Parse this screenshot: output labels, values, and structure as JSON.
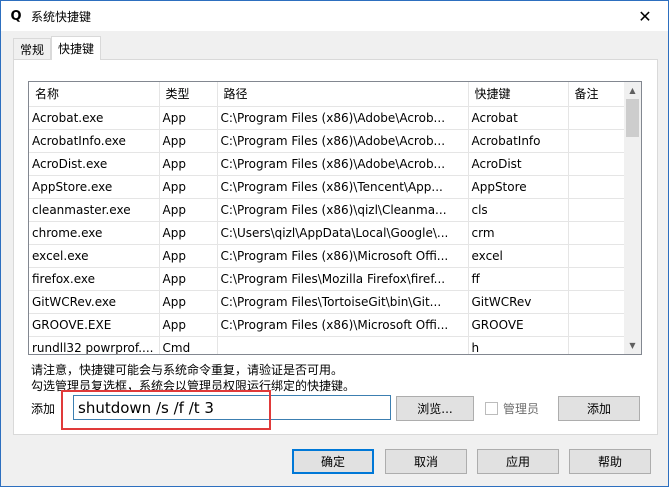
{
  "window": {
    "icon_glyph": "Q",
    "title": "系统快捷键",
    "close_glyph": "✕"
  },
  "tabs": [
    {
      "label": "常规",
      "active": false
    },
    {
      "label": "快捷键",
      "active": true
    }
  ],
  "table": {
    "columns": [
      "名称",
      "类型",
      "路径",
      "快捷键",
      "备注"
    ],
    "rows": [
      [
        "Acrobat.exe",
        "App",
        "C:\\Program Files (x86)\\Adobe\\Acrob...",
        "Acrobat",
        ""
      ],
      [
        "AcrobatInfo.exe",
        "App",
        "C:\\Program Files (x86)\\Adobe\\Acrob...",
        "AcrobatInfo",
        ""
      ],
      [
        "AcroDist.exe",
        "App",
        "C:\\Program Files (x86)\\Adobe\\Acrob...",
        "AcroDist",
        ""
      ],
      [
        "AppStore.exe",
        "App",
        "C:\\Program Files (x86)\\Tencent\\App...",
        "AppStore",
        ""
      ],
      [
        "cleanmaster.exe",
        "App",
        "C:\\Program Files (x86)\\qizl\\Cleanma...",
        "cls",
        ""
      ],
      [
        "chrome.exe",
        "App",
        "C:\\Users\\qizl\\AppData\\Local\\Google\\...",
        "crm",
        ""
      ],
      [
        "excel.exe",
        "App",
        "C:\\Program Files (x86)\\Microsoft Offi...",
        "excel",
        ""
      ],
      [
        "firefox.exe",
        "App",
        "C:\\Program Files\\Mozilla Firefox\\firef...",
        "ff",
        ""
      ],
      [
        "GitWCRev.exe",
        "App",
        "C:\\Program Files\\TortoiseGit\\bin\\Git...",
        "GitWCRev",
        ""
      ],
      [
        "GROOVE.EXE",
        "App",
        "C:\\Program Files (x86)\\Microsoft Offi...",
        "GROOVE",
        ""
      ],
      [
        "rundll32 powrprof....",
        "Cmd",
        "",
        "h",
        ""
      ]
    ]
  },
  "scrollbar": {
    "up_glyph": "▲",
    "down_glyph": "▼"
  },
  "notes": {
    "line1": "请注意，快捷键可能会与系统命令重复，请验证是否可用。",
    "line2": "勾选管理员复选框，系统会以管理员权限运行绑定的快捷键。"
  },
  "add_row": {
    "label": "添加",
    "input_value": "shutdown /s /f /t 3",
    "browse_label": "浏览...",
    "admin_label": "管理员",
    "admin_checked": false,
    "add_button_label": "添加"
  },
  "footer": {
    "ok_label": "确定",
    "cancel_label": "取消",
    "apply_label": "应用",
    "help_label": "帮助"
  },
  "colors": {
    "window_border": "#2d6fbf",
    "highlight_box": "#e03a3a",
    "default_button_border": "#0078d7"
  }
}
